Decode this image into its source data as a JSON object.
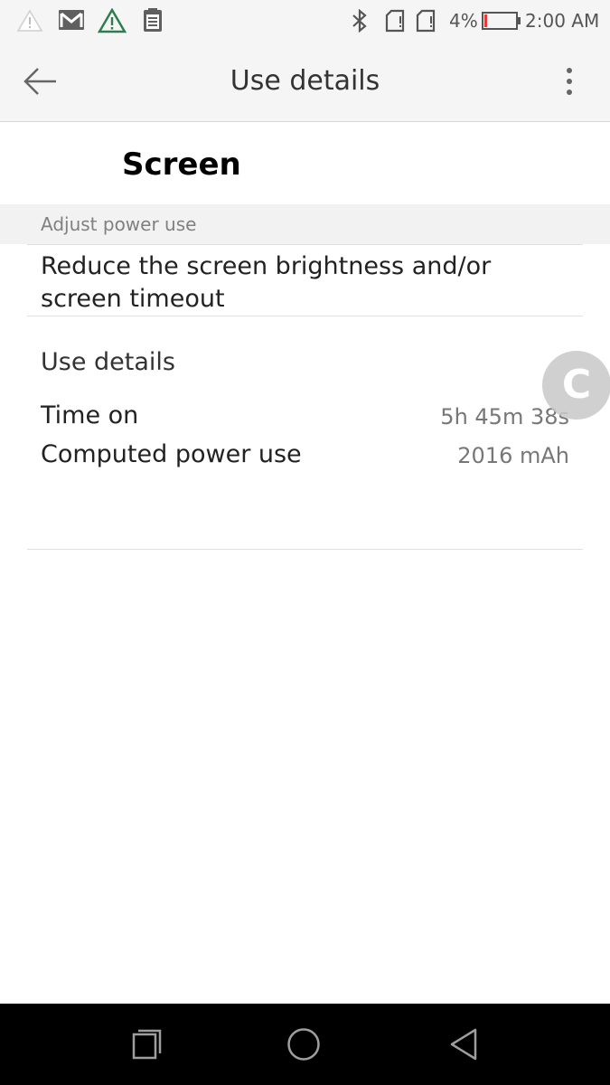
{
  "status_bar": {
    "battery_percent_text": "4%",
    "battery_level_percent": 4,
    "time": "2:00 AM",
    "left_icons": [
      "alert-icon",
      "gmail-icon",
      "warning-triangle-icon",
      "clipboard-icon"
    ],
    "right_icons": [
      "bluetooth-icon",
      "sim-card-1-icon",
      "sim-card-2-icon",
      "battery-icon"
    ]
  },
  "app_bar": {
    "title": "Use details"
  },
  "app_name": "Screen",
  "section": {
    "header": "Adjust power use",
    "advice": "Reduce the screen brightness and/or screen timeout"
  },
  "use_details": {
    "label": "Use details",
    "rows": [
      {
        "label": "Time on",
        "value": "5h 45m 38s"
      },
      {
        "label": "Computed power use",
        "value": "2016 mAh"
      }
    ]
  },
  "floating_button": {
    "label": "C"
  },
  "colors": {
    "battery_low": "#e53935",
    "warning_green": "#2e7d4f"
  }
}
